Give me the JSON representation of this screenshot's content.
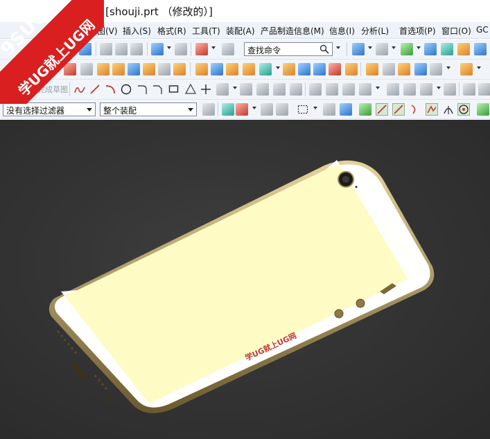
{
  "window": {
    "title": "- [shouji.prt （修改的）]"
  },
  "watermark": {
    "line1": "9SUG",
    "line2": "学UG就上UG网"
  },
  "menubar": {
    "items": [
      {
        "label": "视图(V)"
      },
      {
        "label": "插入(S)"
      },
      {
        "label": "格式(R)"
      },
      {
        "label": "工具(T)"
      },
      {
        "label": "装配(A)"
      },
      {
        "label": "产品制造信息(M)"
      },
      {
        "label": "信息(I)"
      },
      {
        "label": "分析(L)"
      },
      {
        "label": "首选项(P)"
      },
      {
        "label": "窗口(O)"
      },
      {
        "label": "GC"
      }
    ]
  },
  "toolbar": {
    "command_search_placeholder": "查找命令",
    "finish_sketch_label": "完成草图",
    "selection_filter": "没有选择过滤器",
    "selection_scope": "整个装配"
  },
  "model": {
    "engraving_text": "学UG就上UG网"
  },
  "colors": {
    "brand_red": "#d91f1f",
    "viewport_bg": "#343434",
    "phone_frame_gold": "#c9b27a",
    "phone_back_panel": "#fefcc4",
    "phone_end_caps": "#ffffff"
  }
}
